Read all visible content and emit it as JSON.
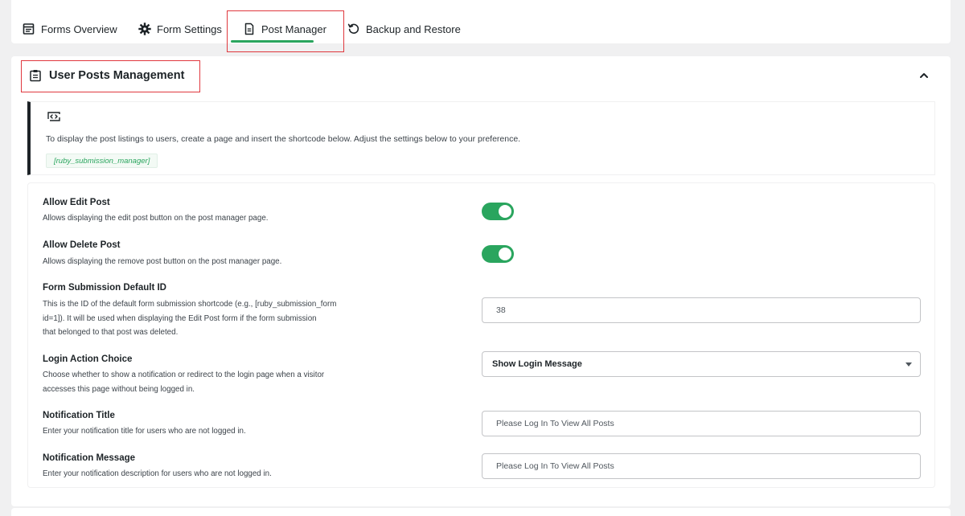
{
  "tabs": [
    {
      "label": "Forms Overview",
      "icon": "forms-overview-icon"
    },
    {
      "label": "Form Settings",
      "icon": "gear-icon"
    },
    {
      "label": "Post Manager",
      "icon": "document-icon"
    },
    {
      "label": "Backup and Restore",
      "icon": "restore-icon"
    }
  ],
  "active_tab": "Post Manager",
  "section": {
    "title": "User Posts Management",
    "title_icon": "clipboard-icon",
    "collapse_icon": "chevron-up-icon"
  },
  "info": {
    "icon": "code-icon",
    "text": "To display the post listings to users, create a page and insert the shortcode below. Adjust the settings below to your preference.",
    "shortcode": "[ruby_submission_manager]"
  },
  "settings": {
    "allow_edit": {
      "label": "Allow Edit Post",
      "description": "Allows displaying the edit post button on the post manager page.",
      "enabled": true
    },
    "allow_delete": {
      "label": "Allow Delete Post",
      "description": "Allows displaying the remove post button on the post manager page.",
      "enabled": true
    },
    "default_id": {
      "label": "Form Submission Default ID",
      "description_lines": [
        "This is the ID of the default form submission shortcode (e.g., [ruby_submission_form",
        "id=1]). It will be used when displaying the Edit Post form if the form submission",
        "that belonged to that post was deleted."
      ],
      "value": "38"
    },
    "login_action": {
      "label": "Login Action Choice",
      "description_lines": [
        "Choose whether to show a notification or redirect to the login page when a visitor",
        "accesses this page without being logged in."
      ],
      "selected": "Show Login Message"
    },
    "notification_title": {
      "label": "Notification Title",
      "description": "Enter your notification title for users who are not logged in.",
      "value": "Please Log In To View All Posts"
    },
    "notification_message": {
      "label": "Notification Message",
      "description": "Enter your notification description for users who are not logged in.",
      "value": "Please Log In To View All Posts"
    }
  },
  "colors": {
    "accent": "#2aa55e",
    "highlight": "#e0383e",
    "text": "#1d2327"
  }
}
